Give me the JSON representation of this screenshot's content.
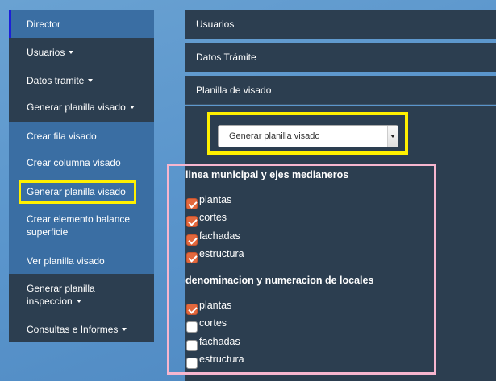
{
  "sidebar": {
    "items": [
      {
        "label": "Director",
        "caret": false
      },
      {
        "label": "Usuarios",
        "caret": true
      },
      {
        "label": "Datos tramite",
        "caret": true
      },
      {
        "label": "Generar planilla visado",
        "caret": true
      },
      {
        "label": "Crear fila visado",
        "caret": false
      },
      {
        "label": "Crear columna visado",
        "caret": false
      },
      {
        "label": "Generar planilla visado",
        "caret": false
      },
      {
        "label": "Crear elemento balance superficie",
        "caret": false
      },
      {
        "label": "Ver planilla visado",
        "caret": false
      },
      {
        "label": "Generar planilla inspeccion",
        "caret": true
      },
      {
        "label": "Consultas e Informes",
        "caret": true
      }
    ]
  },
  "panels": {
    "usuarios": "Usuarios",
    "datos_tramite": "Datos Trámite",
    "planilla_visado": "Planilla de visado"
  },
  "select": {
    "value": "Generar planilla visado"
  },
  "sections": [
    {
      "title": "linea municipal y ejes medianeros",
      "options": [
        {
          "label": "plantas",
          "checked": true
        },
        {
          "label": "cortes",
          "checked": true
        },
        {
          "label": "fachadas",
          "checked": true
        },
        {
          "label": "estructura",
          "checked": true
        }
      ]
    },
    {
      "title": "denominacion y numeracion de locales",
      "options": [
        {
          "label": "plantas",
          "checked": true
        },
        {
          "label": "cortes",
          "checked": false
        },
        {
          "label": "fachadas",
          "checked": false
        },
        {
          "label": "estructura",
          "checked": false
        }
      ]
    }
  ],
  "colors": {
    "highlight_yellow": "#fff000",
    "highlight_pink": "#f7b6cf",
    "panel_dark": "#2c3e50",
    "sidebar_active": "#3a6ea3",
    "checkbox_checked": "#e3683d"
  }
}
